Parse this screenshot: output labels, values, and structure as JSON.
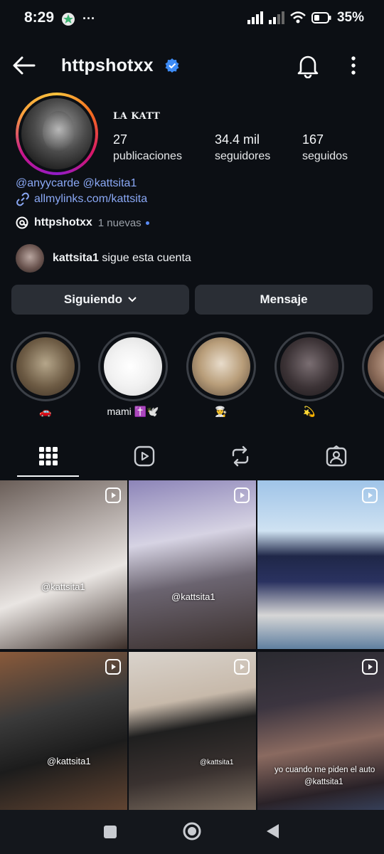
{
  "status": {
    "time": "8:29",
    "battery": "35%"
  },
  "header": {
    "username": "httpshotxx"
  },
  "profile": {
    "display_name": "LA KATT",
    "stats": [
      {
        "num": "27",
        "label": "publicaciones"
      },
      {
        "num": "34.4 mil",
        "label": "seguidores"
      },
      {
        "num": "167",
        "label": "seguidos"
      }
    ],
    "mentions": "@anyycarde @kattsita1",
    "link": "allmylinks.com/kattsita",
    "threads_name": "httpshotxx",
    "threads_new": "1 nuevas",
    "follower_user": "kattsita1",
    "follower_text": " sigue esta cuenta"
  },
  "buttons": {
    "following": "Siguiendo",
    "message": "Mensaje"
  },
  "highlights": [
    {
      "caption": "🚗"
    },
    {
      "caption": "mami ✝️🕊️"
    },
    {
      "caption": "👨‍🍳"
    },
    {
      "caption": "💫"
    },
    {
      "caption": ""
    }
  ],
  "tabs": [
    "grid-icon",
    "reels-icon",
    "reposts-icon",
    "tagged-icon"
  ],
  "grid": [
    {
      "watermark": "@kattsita1"
    },
    {
      "watermark": "@kattsita1"
    },
    {
      "watermark": ""
    },
    {
      "watermark": "@kattsita1"
    },
    {
      "watermark": "@kattsita1"
    },
    {
      "watermark": "@kattsita1",
      "caption": "yo cuando me piden el auto"
    }
  ],
  "colors": {
    "background": "#0c0f14",
    "button": "#2a2e35",
    "link": "#8aa8f5",
    "verified": "#3d8bf5"
  }
}
